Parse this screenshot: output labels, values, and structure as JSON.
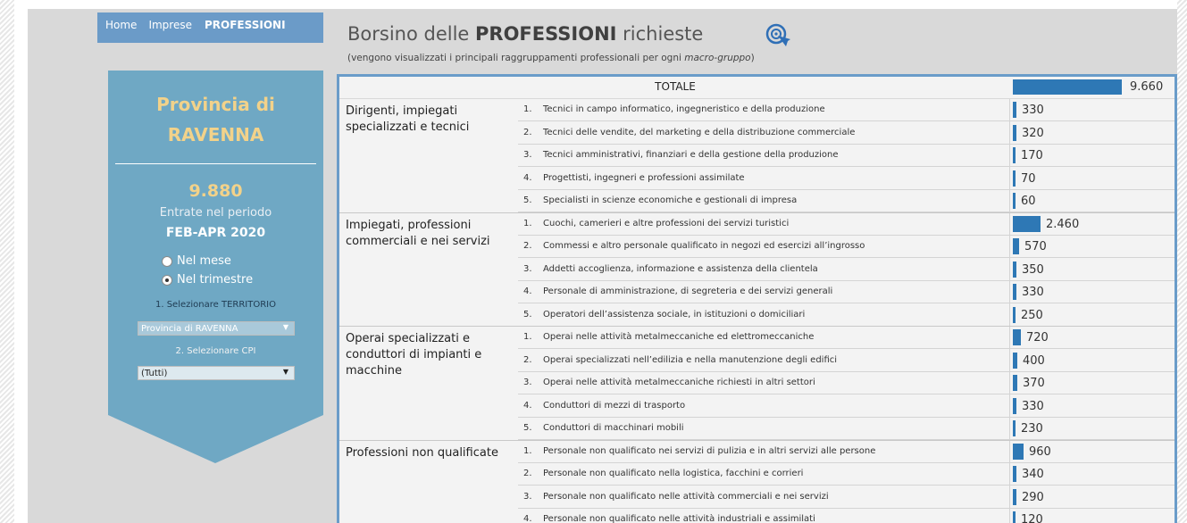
{
  "nav": {
    "items": [
      {
        "label": "Home",
        "active": false
      },
      {
        "label": "Imprese",
        "active": false
      },
      {
        "label": "PROFESSIONI",
        "active": true
      }
    ]
  },
  "header": {
    "title_prefix": "Borsino delle ",
    "title_bold": "PROFESSIONI",
    "title_suffix": " richieste",
    "subtitle_prefix": "(vengono visualizzati i principali raggruppamenti professionali per ogni ",
    "subtitle_italic": "macro-gruppo",
    "subtitle_suffix": ")",
    "icon": "search-target-icon"
  },
  "left_panel": {
    "province_line1": "Provincia di",
    "province_line2": "RAVENNA",
    "total_entries": "9.880",
    "entries_label": "Entrate nel periodo",
    "period": "FEB-APR 2020",
    "radio_options": [
      {
        "label": "Nel mese",
        "checked": false
      },
      {
        "label": "Nel trimestre",
        "checked": true
      }
    ],
    "territory_label": "1. Selezionare TERRITORIO",
    "territory_value": "Provincia di RAVENNA",
    "cpi_label": "2. Selezionare CPI",
    "cpi_value": "(Tutti)"
  },
  "table": {
    "total_label": "TOTALE",
    "total_value": "9.660",
    "total_number": 9660,
    "groups": [
      {
        "label": "Dirigenti, impiegati specializzati e tecnici",
        "rows": [
          {
            "idx": "1.",
            "text": "Tecnici in campo informatico, ingegneristico e della produzione",
            "value": "330",
            "number": 330
          },
          {
            "idx": "2.",
            "text": "Tecnici delle vendite, del marketing e della distribuzione commerciale",
            "value": "320",
            "number": 320
          },
          {
            "idx": "3.",
            "text": "Tecnici amministrativi, finanziari e della gestione della produzione",
            "value": "170",
            "number": 170
          },
          {
            "idx": "4.",
            "text": "Progettisti, ingegneri e professioni assimilate",
            "value": "70",
            "number": 70
          },
          {
            "idx": "5.",
            "text": "Specialisti in scienze economiche e gestionali di impresa",
            "value": "60",
            "number": 60
          }
        ]
      },
      {
        "label": "Impiegati, professioni commerciali e nei servizi",
        "rows": [
          {
            "idx": "1.",
            "text": "Cuochi, camerieri e altre professioni dei servizi turistici",
            "value": "2.460",
            "number": 2460
          },
          {
            "idx": "2.",
            "text": "Commessi e altro personale qualificato in negozi ed esercizi all’ingrosso",
            "value": "570",
            "number": 570
          },
          {
            "idx": "3.",
            "text": "Addetti accoglienza, informazione e assistenza della clientela",
            "value": "350",
            "number": 350
          },
          {
            "idx": "4.",
            "text": "Personale di amministrazione, di segreteria e dei servizi generali",
            "value": "330",
            "number": 330
          },
          {
            "idx": "5.",
            "text": "Operatori dell’assistenza sociale, in istituzioni o domiciliari",
            "value": "250",
            "number": 250
          }
        ]
      },
      {
        "label": "Operai specializzati e conduttori di impianti e macchine",
        "rows": [
          {
            "idx": "1.",
            "text": "Operai nelle attività metalmeccaniche ed elettromeccaniche",
            "value": "720",
            "number": 720
          },
          {
            "idx": "2.",
            "text": "Operai specializzati nell’edilizia e nella manutenzione degli edifici",
            "value": "400",
            "number": 400
          },
          {
            "idx": "3.",
            "text": "Operai nelle attività metalmeccaniche richiesti in altri settori",
            "value": "370",
            "number": 370
          },
          {
            "idx": "4.",
            "text": "Conduttori di mezzi di trasporto",
            "value": "330",
            "number": 330
          },
          {
            "idx": "5.",
            "text": "Conduttori di macchinari mobili",
            "value": "230",
            "number": 230
          }
        ]
      },
      {
        "label": "Professioni non qualificate",
        "rows": [
          {
            "idx": "1.",
            "text": "Personale non qualificato nei servizi di pulizia e in altri servizi alle persone",
            "value": "960",
            "number": 960
          },
          {
            "idx": "2.",
            "text": "Personale non qualificato nella logistica, facchini e corrieri",
            "value": "340",
            "number": 340
          },
          {
            "idx": "3.",
            "text": "Personale non qualificato nelle attività commerciali e nei servizi",
            "value": "290",
            "number": 290
          },
          {
            "idx": "4.",
            "text": "Personale non qualificato nelle attività industriali e assimilati",
            "value": "120",
            "number": 120
          }
        ]
      }
    ]
  },
  "colors": {
    "nav_bg": "#6b9bc8",
    "panel_bg": "#6fa8c4",
    "accent_yellow": "#f2d28a",
    "bar": "#2e78b5",
    "frame": "#6a9cc9"
  }
}
